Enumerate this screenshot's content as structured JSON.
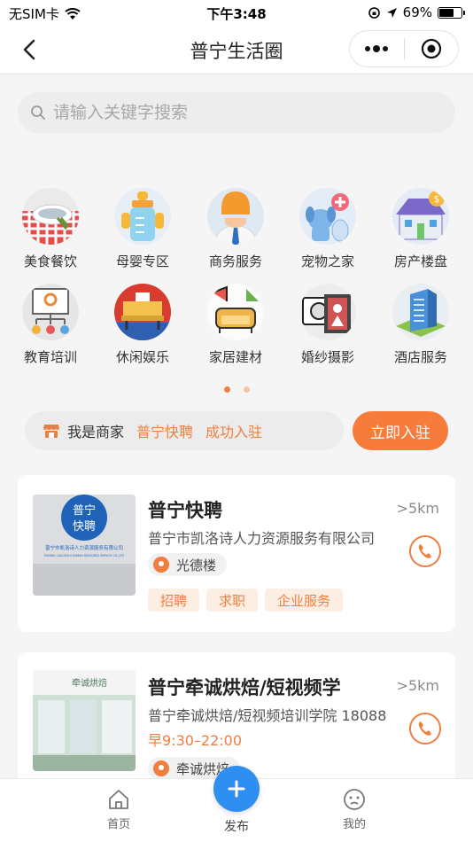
{
  "status_bar": {
    "carrier": "无SIM卡",
    "time": "下午3:48",
    "battery": "69%",
    "battery_level": 0.69
  },
  "nav": {
    "title": "普宁生活圈"
  },
  "search": {
    "placeholder": "请输入关键字搜索"
  },
  "categories": [
    {
      "label": "美食餐饮",
      "icon": "food-icon"
    },
    {
      "label": "母婴专区",
      "icon": "baby-bottle-icon"
    },
    {
      "label": "商务服务",
      "icon": "business-icon"
    },
    {
      "label": "宠物之家",
      "icon": "pet-icon"
    },
    {
      "label": "房产楼盘",
      "icon": "house-icon"
    },
    {
      "label": "教育培训",
      "icon": "education-icon"
    },
    {
      "label": "休闲娱乐",
      "icon": "leisure-icon"
    },
    {
      "label": "家居建材",
      "icon": "sofa-icon"
    },
    {
      "label": "婚纱摄影",
      "icon": "camera-icon"
    },
    {
      "label": "酒店服务",
      "icon": "hotel-icon"
    }
  ],
  "pager": {
    "active_index": 0,
    "count": 2
  },
  "merchant": {
    "label": "我是商家",
    "highlight_name": "普宁快聘",
    "highlight_status": "成功入驻",
    "join_button": "立即入驻"
  },
  "listings": [
    {
      "name": "普宁快聘",
      "distance": ">5km",
      "company": "普宁市凯洛诗人力资源服务有限公司",
      "location": "光德楼",
      "tags": [
        "招聘",
        "求职",
        "企业服务"
      ],
      "thumb_text_1": "普宁",
      "thumb_text_2": "快聘",
      "thumb_caption": "普宁市凯洛诗人力资源服务有限公司",
      "thumb_caption_en": "PUNING CAILUOSHI HUMAN RESOURCE SERVICE CO.,LTD"
    },
    {
      "name": "普宁牵诚烘焙/短视频学",
      "distance": ">5km",
      "company": "普宁牵诚烘焙/短视频培训学院 18088",
      "hours": "早9:30–22:00",
      "location": "牵诚烘焙",
      "thumb_sign": "牵诚烘焙"
    }
  ],
  "tabbar": {
    "home": "首页",
    "publish": "发布",
    "mine": "我的"
  },
  "colors": {
    "accent": "#f07e3c",
    "publish_blue": "#2f8ff0"
  }
}
